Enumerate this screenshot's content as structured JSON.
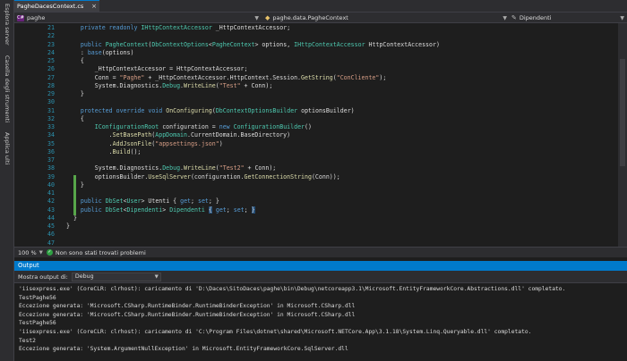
{
  "left_tools": [
    "Esplora server",
    "Casella degli strumenti",
    "Applica ulti"
  ],
  "tab": {
    "label": "PagheDacesContext.cs",
    "close": "×"
  },
  "nav": {
    "project": "paghe",
    "class": "paghe.data.PagheContext",
    "member": "Dipendenti"
  },
  "code": {
    "line_numbers": [
      "21",
      "22",
      "23",
      "24",
      "25",
      "26",
      "27",
      "28",
      "29",
      "30",
      "31",
      "32",
      "33",
      "34",
      "35",
      "36",
      "37",
      "38",
      "39",
      "40",
      "41",
      "42",
      "43",
      "44",
      "45",
      "46",
      "47",
      "48"
    ],
    "lines": [
      "    private readonly IHttpContextAccessor _HttpContextAccessor;",
      "",
      "    public PagheContext(DbContextOptions<PagheContext> options, IHttpContextAccessor HttpContextAccessor)",
      "    : base(options)",
      "    {",
      "        _HttpContextAccessor = HttpContextAccessor;",
      "        Conn = \"Paghe\" + _HttpContextAccessor.HttpContext.Session.GetString(\"ConCliente\");",
      "        System.Diagnostics.Debug.WriteLine(\"Test\" + Conn);",
      "    }",
      "",
      "    protected override void OnConfiguring(DbContextOptionsBuilder optionsBuilder)",
      "    {",
      "        IConfigurationRoot configuration = new ConfigurationBuilder()",
      "            .SetBasePath(AppDomain.CurrentDomain.BaseDirectory)",
      "            .AddJsonFile(\"appsettings.json\")",
      "            .Build();",
      "",
      "        System.Diagnostics.Debug.WriteLine(\"Test2\" + Conn);",
      "        optionsBuilder.UseSqlServer(configuration.GetConnectionString(Conn));",
      "    }",
      "",
      "    public DbSet<User> Utenti { get; set; }",
      "    public DbSet<Dipendenti> Dipendenti { get; set; }",
      "  }",
      "}",
      "",
      "",
      ""
    ]
  },
  "status": {
    "zoom": "100 %",
    "problems": "Non sono stati trovati problemi"
  },
  "output": {
    "title": "Output",
    "source_label": "Mostra output di:",
    "source_value": "Debug",
    "lines": [
      "'iisexpress.exe' (CoreCLR: clrhost): caricamento di 'D:\\Daces\\SitoDaces\\paghe\\bin\\Debug\\netcoreapp3.1\\Microsoft.EntityFrameworkCore.Abstractions.dll' completato.",
      "TestPaghe56",
      "Eccezione generata: 'Microsoft.CSharp.RuntimeBinder.RuntimeBinderException' in Microsoft.CSharp.dll",
      "Eccezione generata: 'Microsoft.CSharp.RuntimeBinder.RuntimeBinderException' in Microsoft.CSharp.dll",
      "TestPaghe56",
      "'iisexpress.exe' (CoreCLR: clrhost): caricamento di 'C:\\Program Files\\dotnet\\shared\\Microsoft.NETCore.App\\3.1.18\\System.Linq.Queryable.dll' completato.",
      "Test2",
      "Eccezione generata: 'System.ArgumentNullException' in Microsoft.EntityFrameworkCore.SqlServer.dll"
    ]
  },
  "colors": {
    "accent": "#007acc",
    "keyword": "#569cd6",
    "type": "#4ec9b0",
    "string": "#d69d85",
    "linenumber": "#2b91af"
  }
}
